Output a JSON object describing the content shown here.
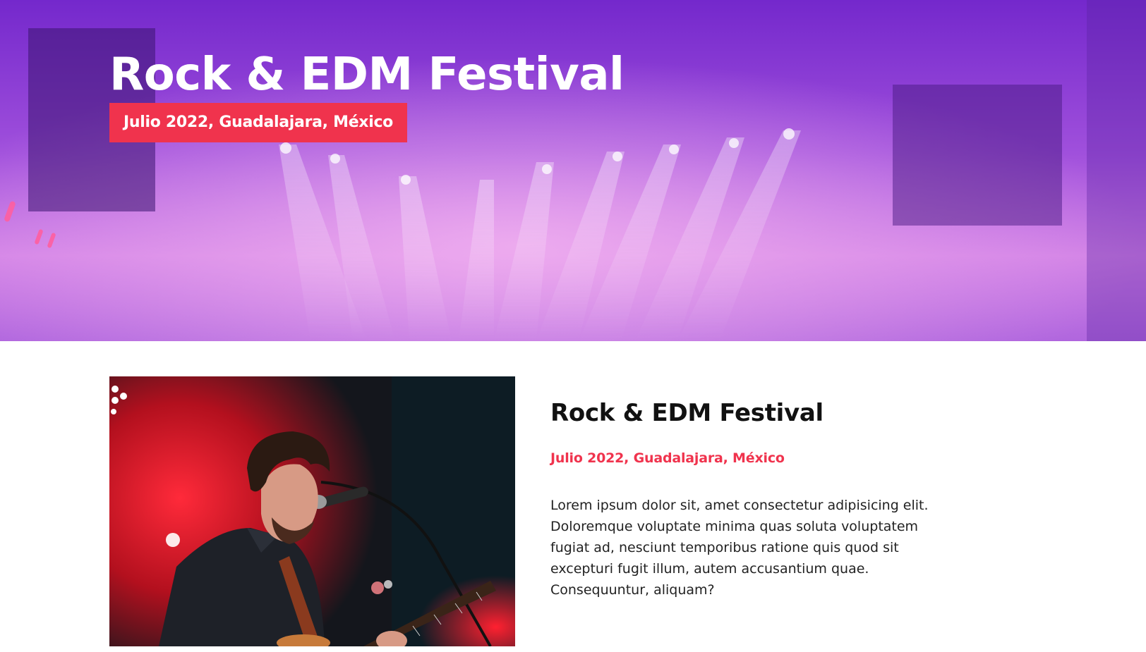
{
  "hero": {
    "title": "Rock & EDM Festival",
    "badge": "Julio 2022, Guadalajara, México",
    "background_image": "concert-stage-purple-lights"
  },
  "event": {
    "image": "guitarist-singing-on-stage",
    "title": "Rock & EDM Festival",
    "subtitle": "Julio 2022, Guadalajara, México",
    "description": "Lorem ipsum dolor sit, amet consectetur adipisicing elit. Doloremque voluptate minima quas soluta voluptatem fugiat ad, nesciunt temporibus ratione quis quod sit excepturi fugit illum, autem accusantium quae. Consequuntur, aliquam?"
  },
  "colors": {
    "accent": "#f0334d",
    "hero_overlay": "#8a3ad6",
    "text_dark": "#111111",
    "text_body": "#222222"
  }
}
